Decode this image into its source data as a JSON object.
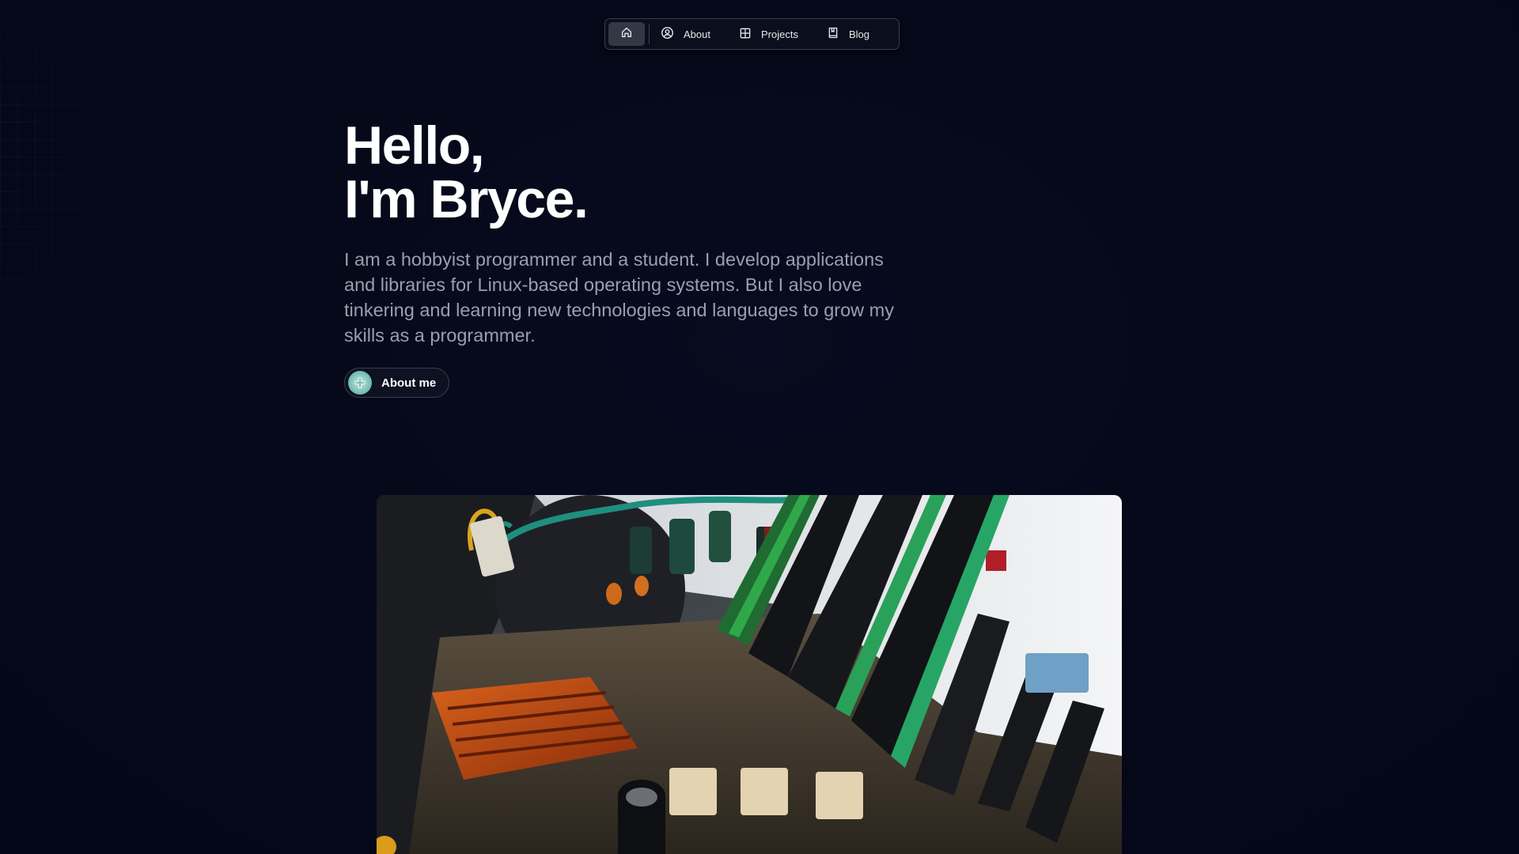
{
  "nav": {
    "items": [
      {
        "label": "About",
        "icon": "user-circle-icon"
      },
      {
        "label": "Projects",
        "icon": "grid-icon"
      },
      {
        "label": "Blog",
        "icon": "bookmark-book-icon"
      }
    ],
    "home_icon": "home-icon"
  },
  "hero": {
    "title_line1": "Hello,",
    "title_line2": "I'm Bryce.",
    "description": "I am a hobbyist programmer and a student. I develop applications and libraries for Linux-based operating systems. But I also love tinkering and learning new technologies and languages to grow my skills as a programmer.",
    "cta_label": "About me"
  },
  "colors": {
    "background": "#050818",
    "text": "#ffffff",
    "muted": "#9a9fae",
    "border": "#3a3e4e"
  }
}
